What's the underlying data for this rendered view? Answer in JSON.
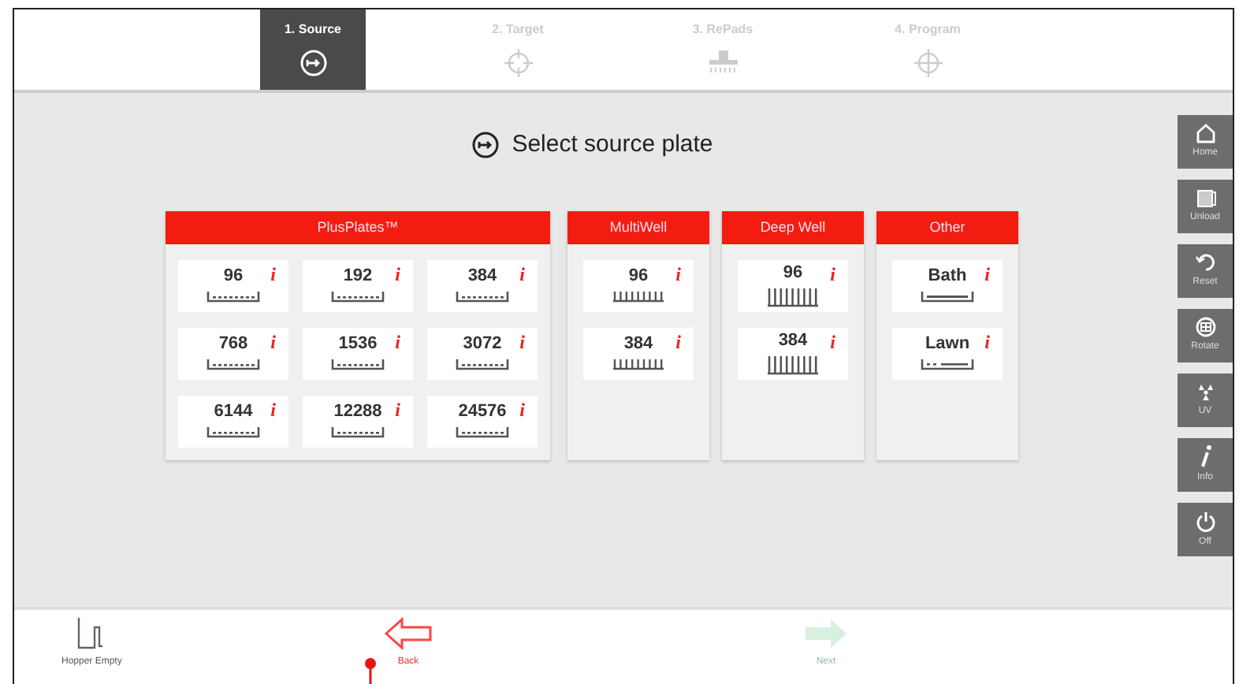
{
  "steps": [
    {
      "label": "1. Source",
      "kind": "source",
      "selected": true
    },
    {
      "label": "2. Target",
      "kind": "target",
      "selected": false
    },
    {
      "label": "3. RePads",
      "kind": "repads",
      "selected": false
    },
    {
      "label": "4. Program",
      "kind": "program",
      "selected": false
    }
  ],
  "title": {
    "text": "Select source plate",
    "kind": "source"
  },
  "groups": [
    {
      "name": "PlusPlates™",
      "plates": [
        {
          "label": "96",
          "kind": "flat",
          "info": "i"
        },
        {
          "label": "192",
          "kind": "flat",
          "info": "i"
        },
        {
          "label": "384",
          "kind": "flat",
          "info": "i"
        },
        {
          "label": "768",
          "kind": "flat",
          "info": "i"
        },
        {
          "label": "1536",
          "kind": "flat",
          "info": "i"
        },
        {
          "label": "3072",
          "kind": "flat",
          "info": "i"
        },
        {
          "label": "6144",
          "kind": "flat",
          "info": "i"
        },
        {
          "label": "12288",
          "kind": "flat",
          "info": "i"
        },
        {
          "label": "24576",
          "kind": "flat",
          "info": "i"
        }
      ]
    },
    {
      "name": "MultiWell",
      "plates": [
        {
          "label": "96",
          "kind": "wells",
          "info": "i"
        },
        {
          "label": "384",
          "kind": "wells",
          "info": "i"
        }
      ]
    },
    {
      "name": "Deep Well",
      "plates": [
        {
          "label": "96",
          "kind": "deep",
          "info": "i"
        },
        {
          "label": "384",
          "kind": "deep",
          "info": "i"
        }
      ]
    },
    {
      "name": "Other",
      "plates": [
        {
          "label": "Bath",
          "kind": "bath",
          "info": "i"
        },
        {
          "label": "Lawn",
          "kind": "lawn",
          "info": "i"
        }
      ]
    }
  ],
  "sidebar": [
    {
      "label": "Home",
      "kind": "home"
    },
    {
      "label": "Unload",
      "kind": "unload"
    },
    {
      "label": "Reset",
      "kind": "reset"
    },
    {
      "label": "Rotate",
      "kind": "rotate"
    },
    {
      "label": "UV",
      "kind": "uv"
    },
    {
      "label": "Info",
      "kind": "info"
    },
    {
      "label": "Off",
      "kind": "power"
    }
  ],
  "footer": [
    {
      "label": "Hopper Empty",
      "kind": "hopper",
      "disabled": false
    },
    {
      "label": "Back",
      "kind": "back",
      "disabled": false
    },
    {
      "label": "Next",
      "kind": "next",
      "disabled": true
    }
  ]
}
